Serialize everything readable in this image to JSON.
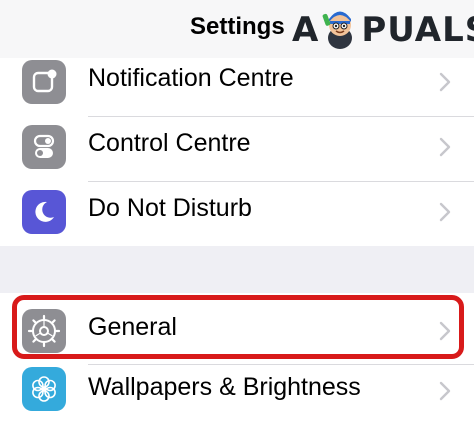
{
  "nav": {
    "title": "Settings"
  },
  "watermark": {
    "text_before": "A",
    "text_after": "PUALS"
  },
  "groups": [
    {
      "items": [
        {
          "label": "Notification Centre",
          "icon": "notification-centre-icon",
          "icon_color": "#8e8e93"
        },
        {
          "label": "Control Centre",
          "icon": "control-centre-icon",
          "icon_color": "#8e8e93"
        },
        {
          "label": "Do Not Disturb",
          "icon": "moon-icon",
          "icon_color": "#5856d6"
        }
      ]
    },
    {
      "items": [
        {
          "label": "General",
          "icon": "gear-icon",
          "icon_color": "#8e8e93",
          "highlighted": true
        },
        {
          "label": "Wallpapers & Brightness",
          "icon": "flower-icon",
          "icon_color": "#34aadc"
        }
      ]
    }
  ],
  "colors": {
    "highlight": "#d81a1a",
    "background": "#efeff4",
    "chevron": "#c7c7cc"
  }
}
